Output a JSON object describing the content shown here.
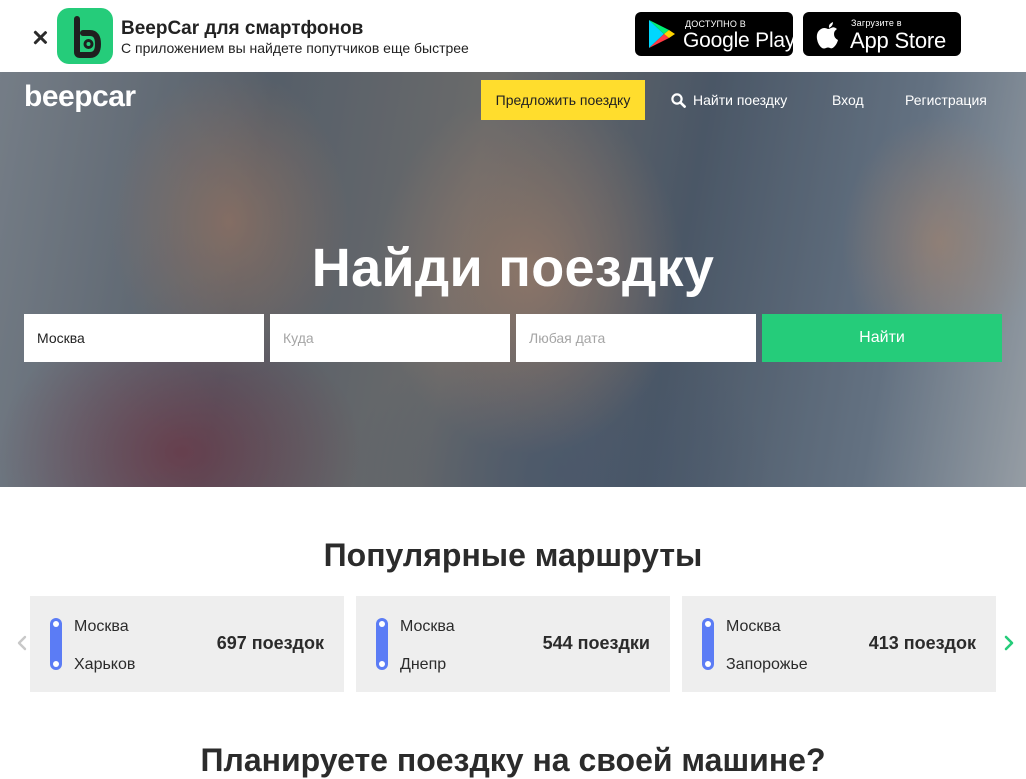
{
  "banner": {
    "title": "BeepCar для смартфонов",
    "subtitle": "С приложением вы найдете попутчиков еще быстрее",
    "google_play": {
      "caption": "ДОСТУПНО В",
      "label": "Google Play"
    },
    "app_store": {
      "caption": "Загрузите в",
      "label": "App Store"
    },
    "icon_color": "#25cc7a"
  },
  "header": {
    "logo": "beepcar",
    "offer_button": "Предложить поездку",
    "find_link": "Найти поездку",
    "login_link": "Вход",
    "register_link": "Регистрация",
    "offer_button_color": "#ffdd2d"
  },
  "hero": {
    "headline": "Найди поездку",
    "from_value": "Москва",
    "to_placeholder": "Куда",
    "date_placeholder": "Любая дата",
    "search_button": "Найти",
    "search_button_color": "#25cc7a"
  },
  "popular": {
    "title": "Популярные маршруты",
    "routes": [
      {
        "from": "Москва",
        "to": "Харьков",
        "count": "697 поездок"
      },
      {
        "from": "Москва",
        "to": "Днепр",
        "count": "544 поездки"
      },
      {
        "from": "Москва",
        "to": "Запорожье",
        "count": "413 поездок"
      }
    ],
    "route_line_color": "#5b7cf5",
    "arrow_right_color": "#25cc7a"
  },
  "next_section": {
    "title": "Планируете поездку на своей машине?"
  }
}
